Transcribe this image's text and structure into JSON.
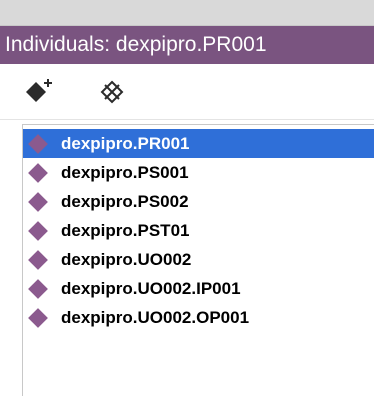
{
  "panel": {
    "title": "Individuals: dexpipro.PR001"
  },
  "toolbar": {
    "add_icon": "add-individual-icon",
    "delete_icon": "delete-individual-icon"
  },
  "individuals": [
    {
      "label": "dexpipro.PR001",
      "selected": true
    },
    {
      "label": "dexpipro.PS001",
      "selected": false
    },
    {
      "label": "dexpipro.PS002",
      "selected": false
    },
    {
      "label": "dexpipro.PST01",
      "selected": false
    },
    {
      "label": "dexpipro.UO002",
      "selected": false
    },
    {
      "label": "dexpipro.UO002.IP001",
      "selected": false
    },
    {
      "label": "dexpipro.UO002.OP001",
      "selected": false
    }
  ],
  "colors": {
    "header_bg": "#7a5480",
    "selection": "#2f6fd8",
    "individual_icon": "#8b5a8e"
  }
}
